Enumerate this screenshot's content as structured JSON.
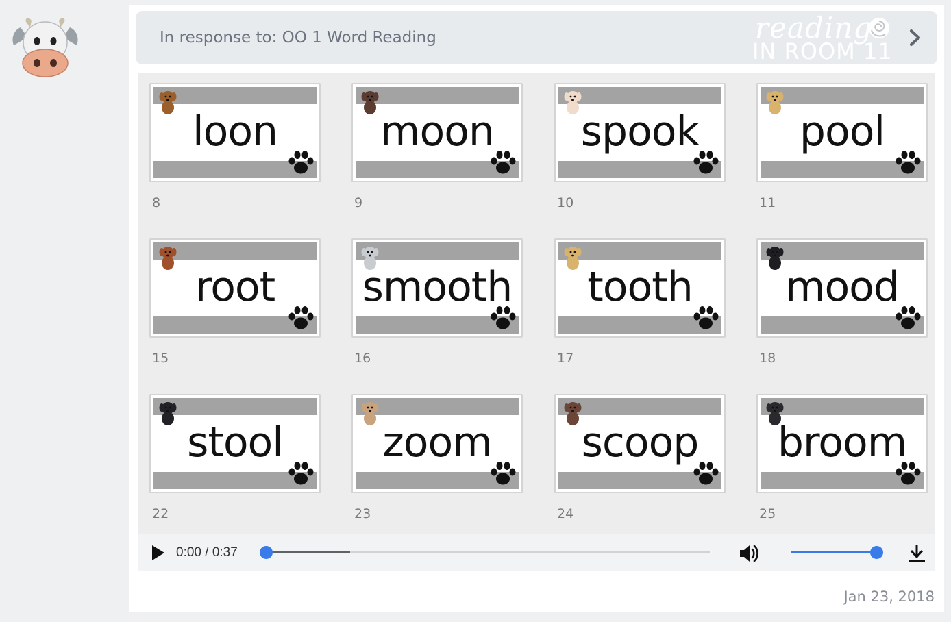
{
  "avatar": {
    "icon": "cow-face-emoji-icon"
  },
  "header": {
    "response_text": "In response to: OO 1 Word Reading",
    "logo_word": "reading",
    "logo_sub": "IN ROOM 11",
    "chevron_icon": "chevron-right-icon"
  },
  "slides": [
    {
      "word": "loon",
      "number": "8",
      "dog_color": "#9a5f2a"
    },
    {
      "word": "moon",
      "number": "9",
      "dog_color": "#5a3c30"
    },
    {
      "word": "spook",
      "number": "10",
      "dog_color": "#f1dccb"
    },
    {
      "word": "pool",
      "number": "11",
      "dog_color": "#d9b36b"
    },
    {
      "word": "root",
      "number": "15",
      "dog_color": "#a0502a"
    },
    {
      "word": "smooth",
      "number": "16",
      "dog_color": "#c8ccd0"
    },
    {
      "word": "tooth",
      "number": "17",
      "dog_color": "#d9b36b"
    },
    {
      "word": "mood",
      "number": "18",
      "dog_color": "#1e1e22"
    },
    {
      "word": "stool",
      "number": "22",
      "dog_color": "#222226"
    },
    {
      "word": "zoom",
      "number": "23",
      "dog_color": "#c9a27e"
    },
    {
      "word": "scoop",
      "number": "24",
      "dog_color": "#6a4538"
    },
    {
      "word": "broom",
      "number": "25",
      "dog_color": "#2a2a2e"
    }
  ],
  "audio": {
    "time": "0:00 / 0:37",
    "progress": 0.0,
    "buffered": 0.19,
    "volume": 1.0,
    "accent_color": "#3a7bea"
  },
  "date": "Jan 23, 2018"
}
